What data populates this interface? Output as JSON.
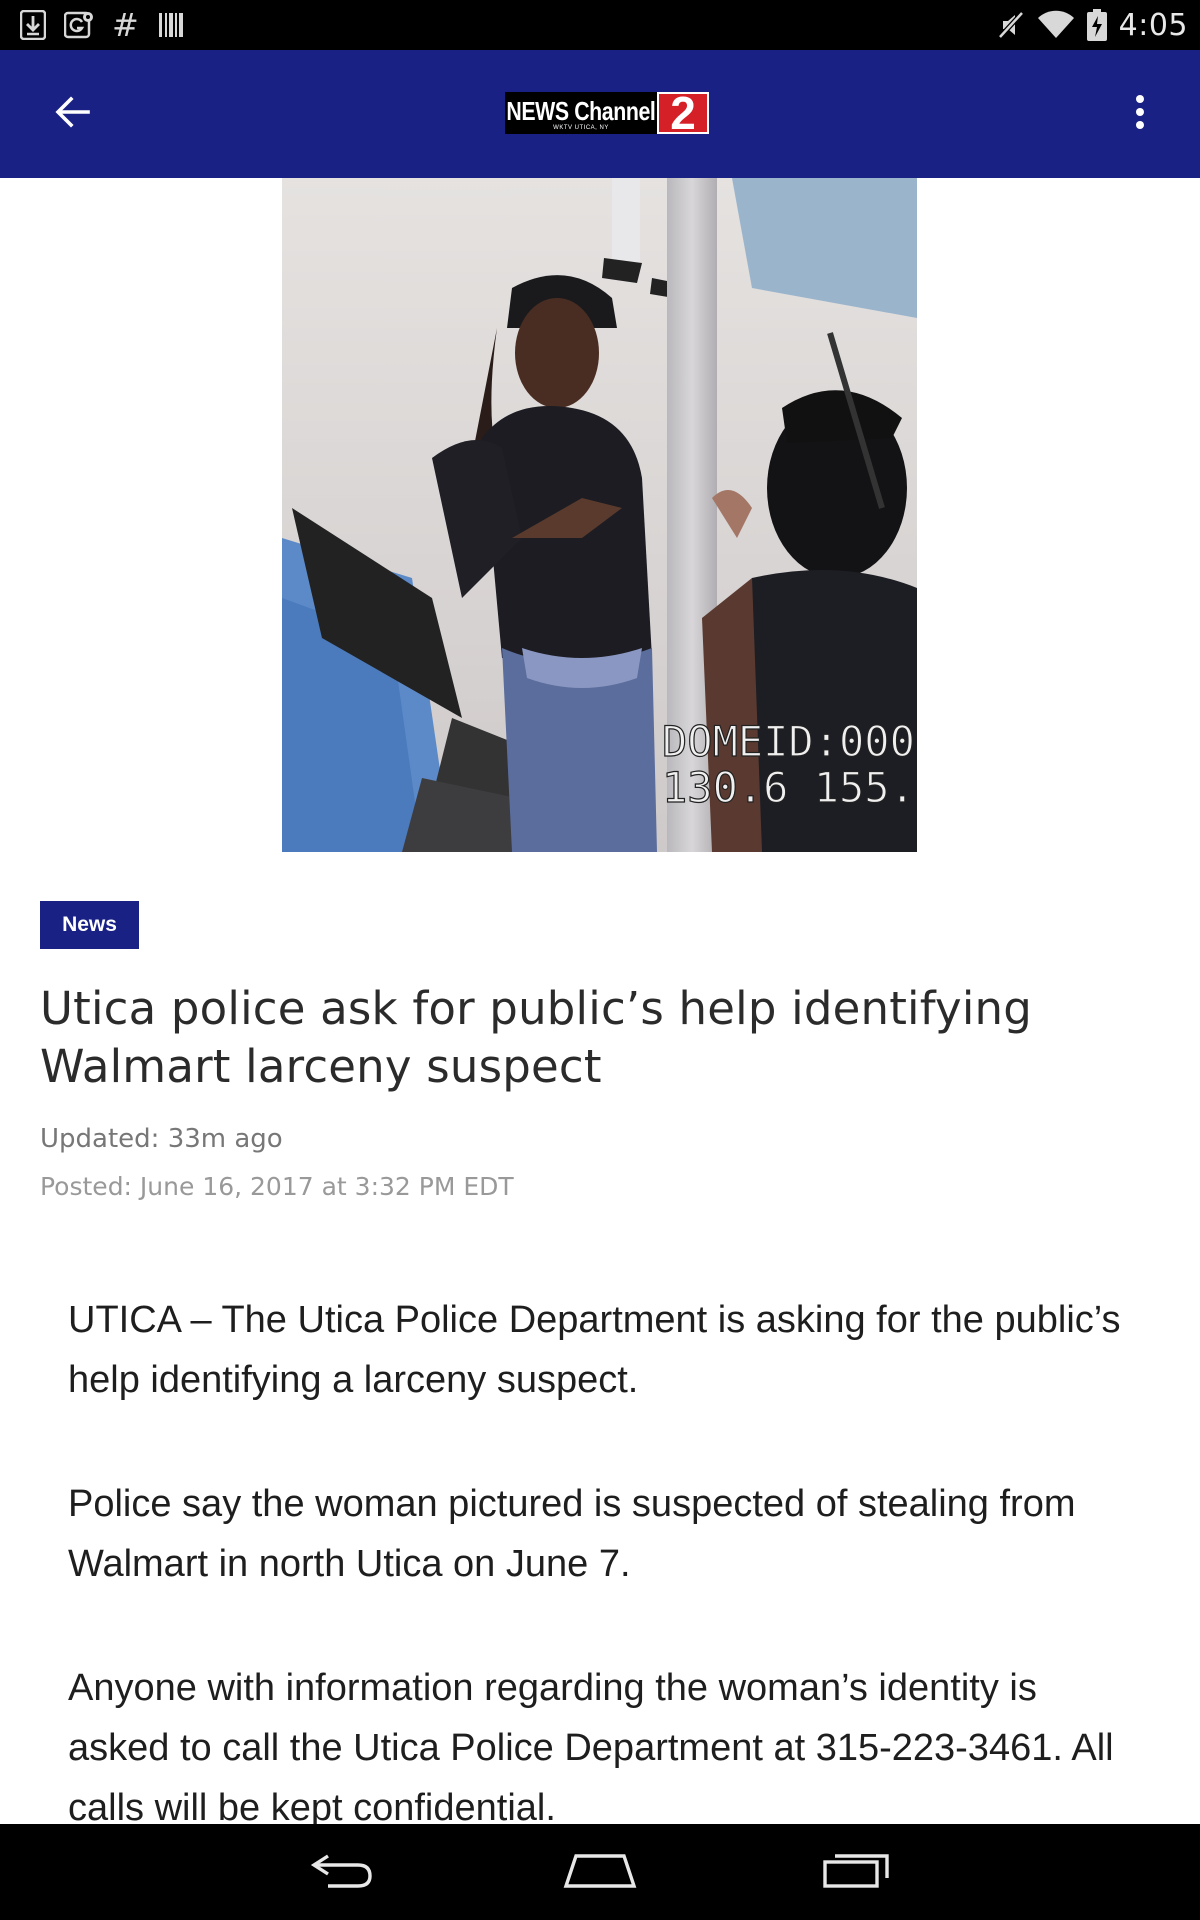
{
  "status_bar": {
    "left_icons": [
      "download-icon",
      "maps-notification-icon",
      "hash-icon",
      "barcode-icon"
    ],
    "hash_glyph": "#",
    "right_icons": [
      "mute-icon",
      "wifi-icon",
      "battery-charging-icon"
    ],
    "time": "4:05"
  },
  "app_bar": {
    "background": "#1a2185",
    "logo": {
      "text": "NEWS Channel",
      "subtext": "WKTV UTICA, NY",
      "number": "2",
      "number_color": "#d62027"
    },
    "back_icon": "arrow-left-icon",
    "menu_icon": "more-vert-icon"
  },
  "hero_image": {
    "description_icon": "surveillance-photo",
    "overlay_line1": "DOMEID:000",
    "overlay_line2": "130.6 155."
  },
  "article": {
    "category": "News",
    "category_color": "#1a2185",
    "title": "Utica police ask for public’s help identifying Walmart larceny suspect",
    "updated": "Updated: 33m ago",
    "posted": "Posted: June 16, 2017 at 3:32 PM EDT",
    "paragraphs": [
      "UTICA – The Utica Police Department is asking for the public’s help identifying a larceny suspect.",
      "Police say the woman pictured is suspected of stealing from Walmart in north Utica on June 7.",
      "Anyone with information regarding the woman’s identity is asked to call the Utica Police Department at 315-223-3461. All calls will be kept confidential."
    ]
  },
  "nav_bar": {
    "buttons": [
      "back-nav-icon",
      "home-nav-icon",
      "recents-nav-icon"
    ]
  }
}
